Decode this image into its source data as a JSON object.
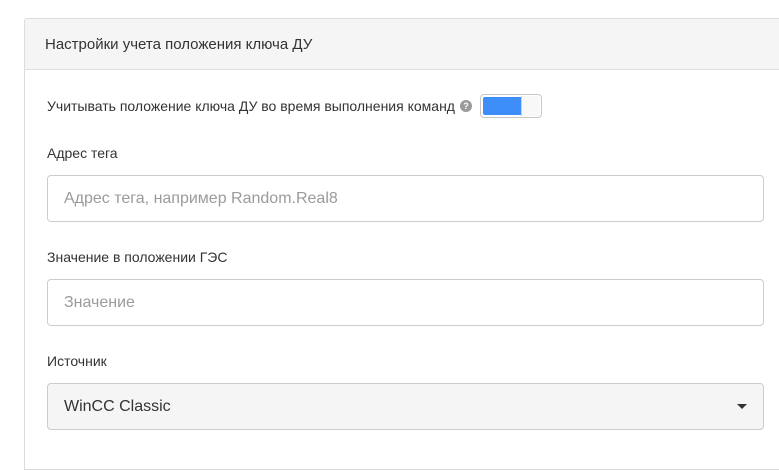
{
  "panel": {
    "title": "Настройки учета положения ключа ДУ"
  },
  "toggle": {
    "label": "Учитывать положение ключа ДУ во время выполнения команд",
    "help_glyph": "?",
    "enabled": true,
    "accent_color": "#3d8ef8"
  },
  "fields": {
    "tag_address": {
      "label": "Адрес тега",
      "value": "",
      "placeholder": "Адрес тега, например Random.Real8"
    },
    "value_in_position": {
      "label": "Значение в положении ГЭС",
      "value": "",
      "placeholder": "Значение"
    },
    "source": {
      "label": "Источник",
      "selected": "WinCC Classic"
    }
  },
  "icons": {
    "help": "question-circle-icon",
    "dropdown": "caret-down-icon"
  }
}
